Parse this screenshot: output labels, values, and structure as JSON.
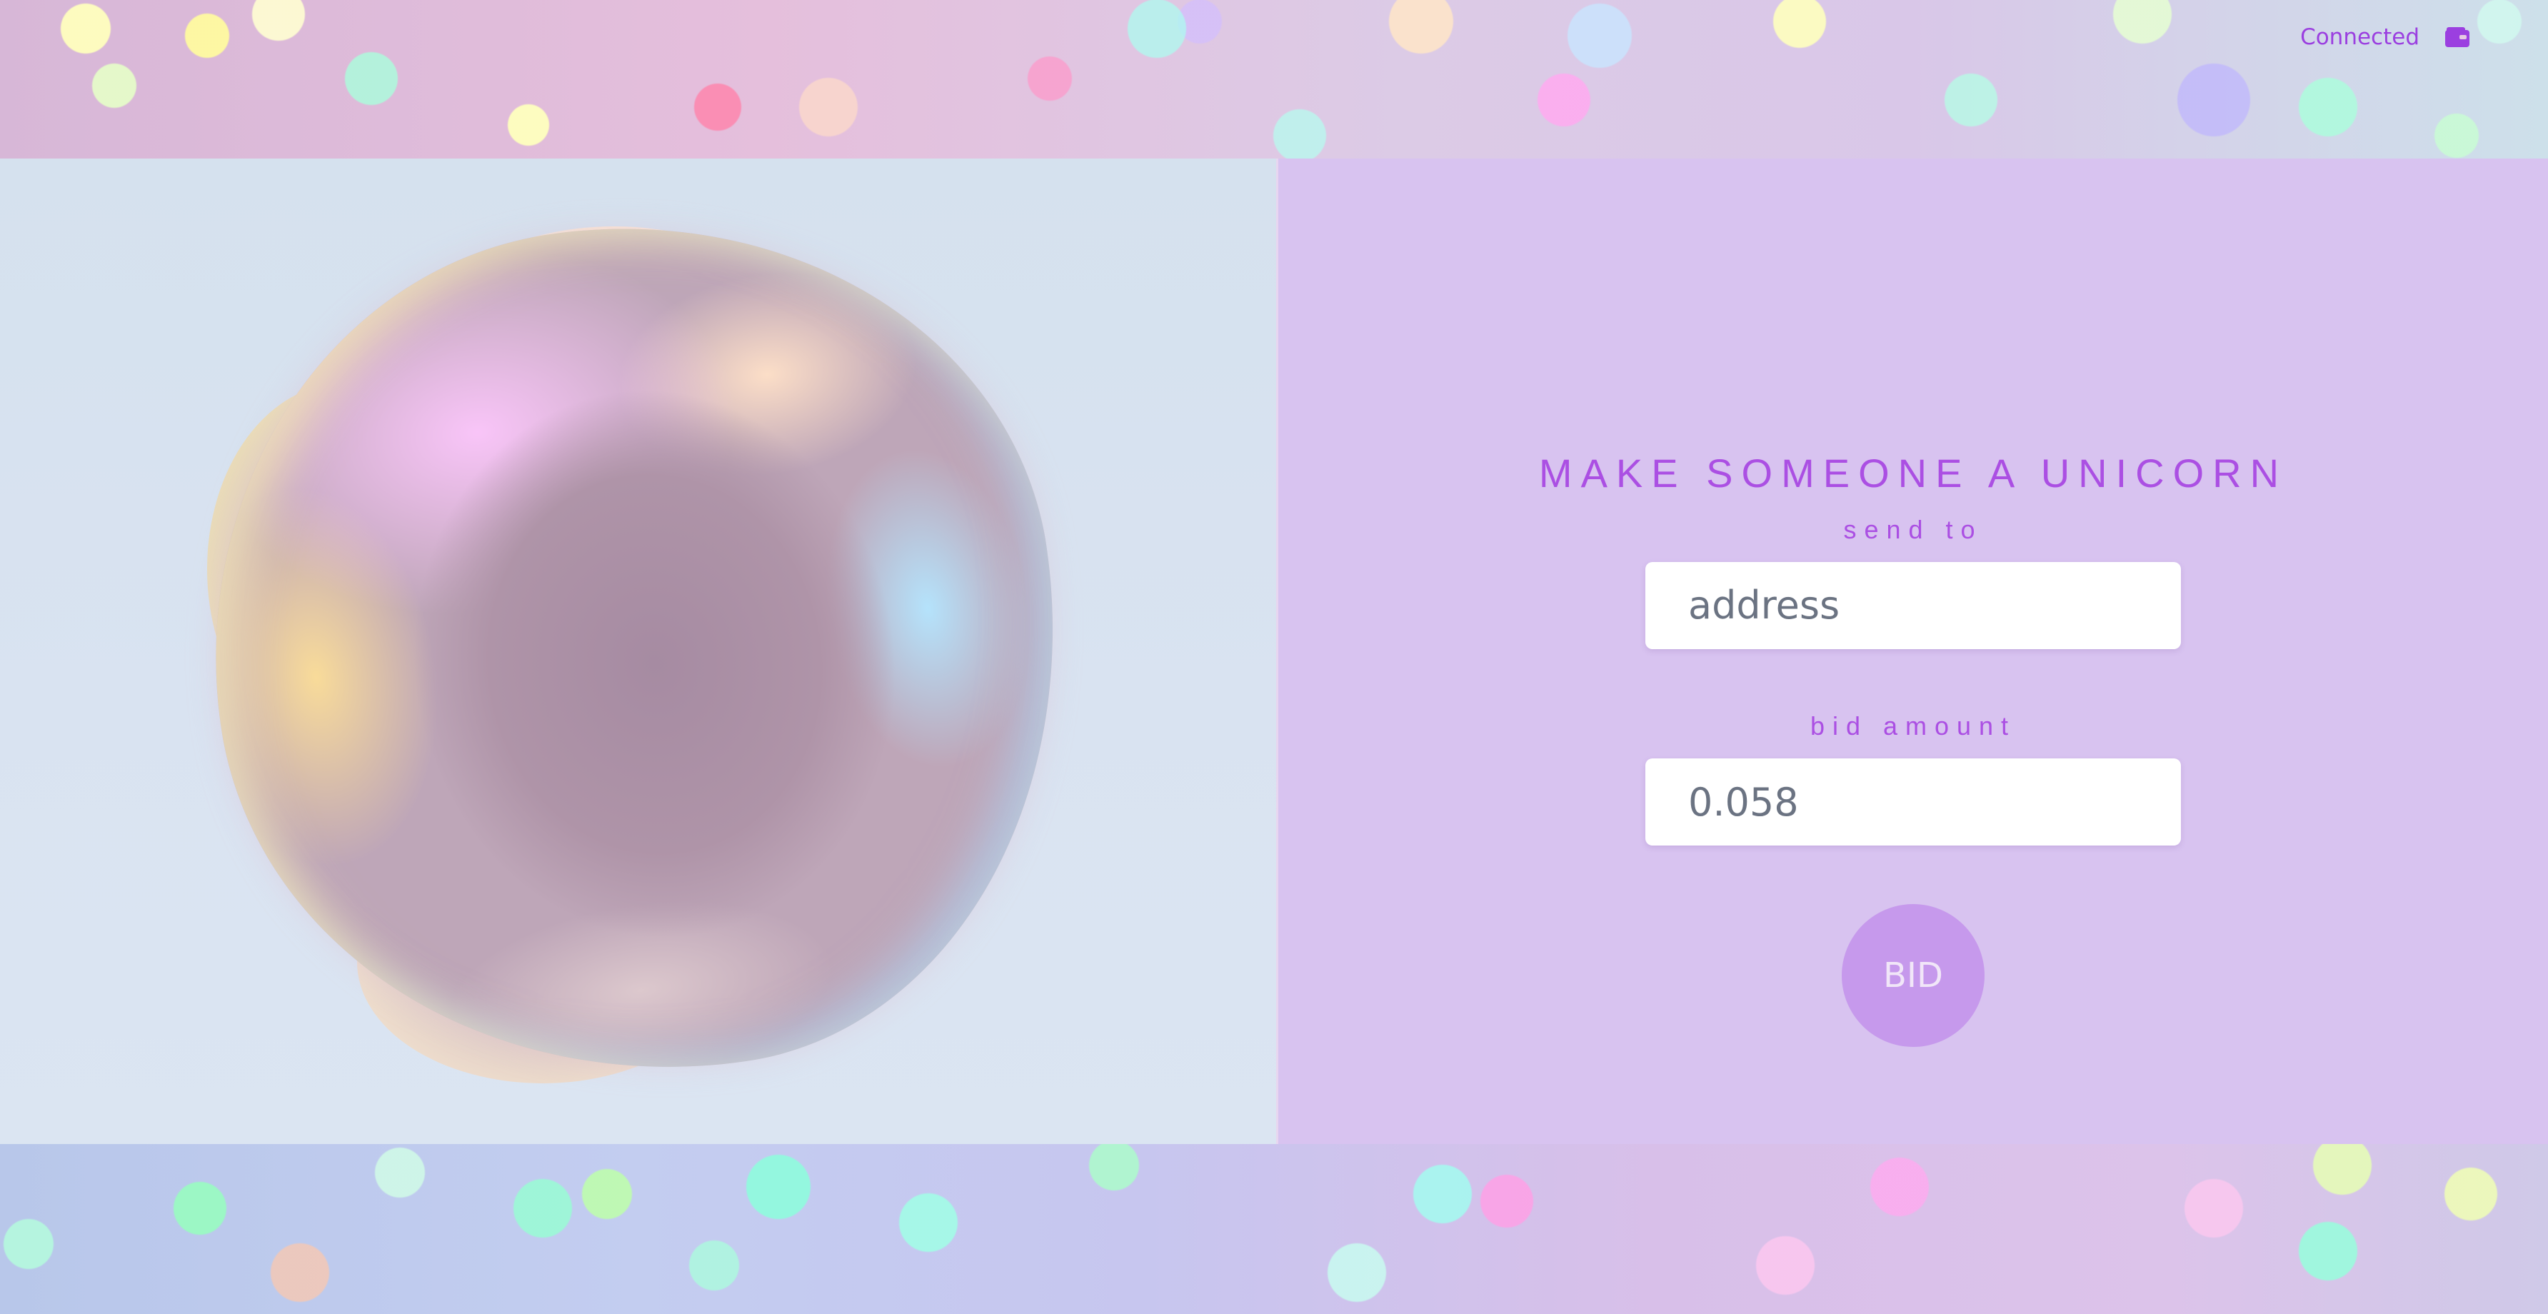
{
  "header": {
    "status_text": "Connected",
    "wallet_icon": "wallet-icon"
  },
  "form": {
    "headline": "MAKE SOMEONE A UNICORN",
    "send_to_label": "send to",
    "address_placeholder": "address",
    "bid_amount_label": "bid amount",
    "bid_amount_value": "0.058",
    "bid_button_label": "BID"
  },
  "colors": {
    "accent": "#ab4fe3",
    "panel_background": "#d8c3f0",
    "button_background": "#c699ec",
    "art_background": "#d7e2ef"
  }
}
